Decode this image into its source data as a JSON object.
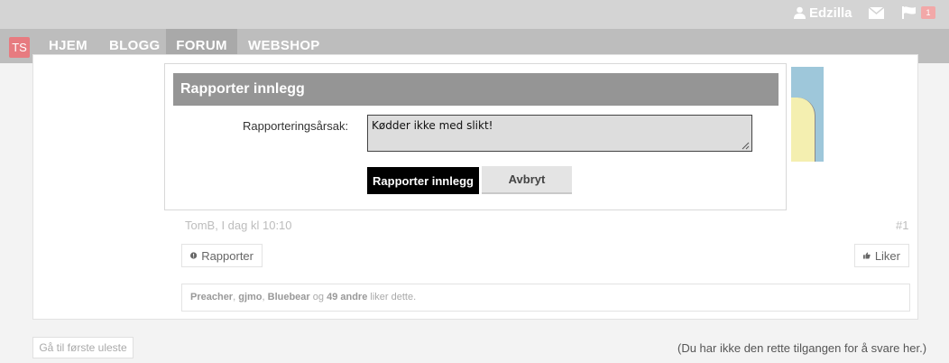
{
  "topbar": {
    "username": "Edzilla",
    "notifications_count": "1",
    "icons": [
      "user-icon",
      "mail-icon",
      "flag-icon"
    ]
  },
  "nav": {
    "logo_text": "TS",
    "items": [
      {
        "label": "HJEM"
      },
      {
        "label": "BLOGG"
      },
      {
        "label": "FORUM"
      },
      {
        "label": "WEBSHOP"
      }
    ],
    "active": "FORUM"
  },
  "modal": {
    "title": "Rapporter innlegg",
    "reason_label": "Rapporteringsårsak:",
    "reason_value": "Kødder ikke med slikt!",
    "submit_label": "Rapporter innlegg",
    "cancel_label": "Avbryt"
  },
  "post": {
    "meta": "TomB, I dag kl 10:10",
    "number": "#1",
    "report_label": "Rapporter",
    "like_label": "Liker",
    "likes": {
      "user1": "Preacher",
      "sep1": ",",
      "user2": "gjmo",
      "sep2": ",",
      "user3": "Bluebear",
      "and": "og",
      "others": "49 andre",
      "suffix": "liker dette."
    }
  },
  "footer": {
    "first_unread": "Gå til første uleste",
    "no_permission": "(Du har ikke den rette tilgangen for å svare her.)"
  },
  "colors": {
    "topbar": "#d4d4d4",
    "navbar": "#bdbdbd",
    "nav_active": "#a9a9a9",
    "modal_header": "#959595",
    "logo": "#e77b80"
  }
}
